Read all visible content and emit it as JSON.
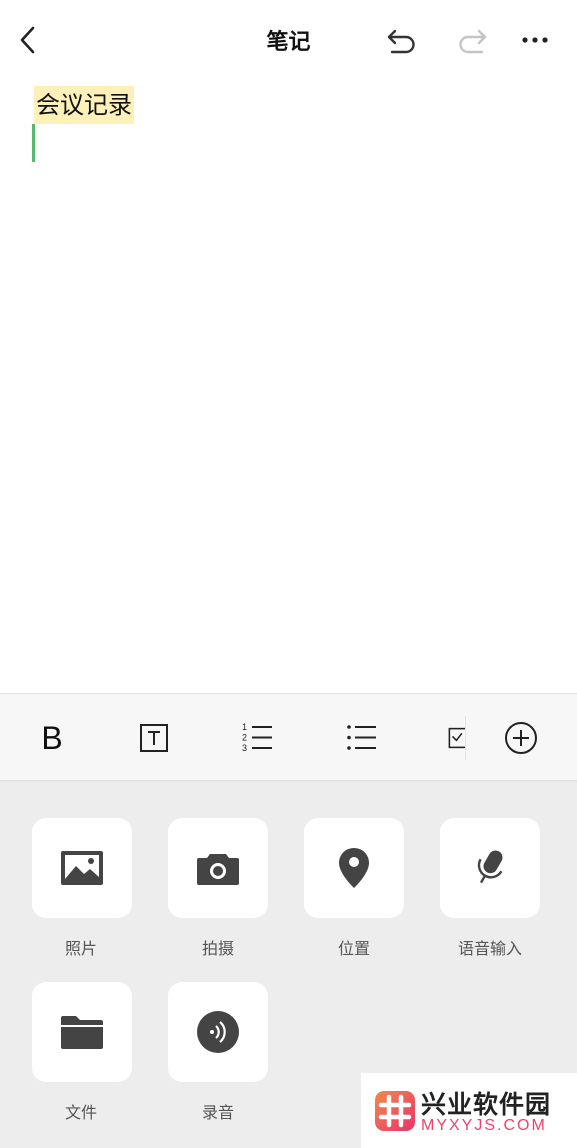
{
  "header": {
    "title": "笔记",
    "icons": [
      "back-arrow-icon",
      "undo-icon",
      "redo-icon",
      "more-icon"
    ]
  },
  "editor": {
    "lines": [
      "会议记录"
    ],
    "highlight_color": "#fdf0b8",
    "caret_color": "#59b86b"
  },
  "format_toolbar": {
    "bold_label": "B",
    "icons": [
      "text-style-icon",
      "numbered-list-icon",
      "bullet-list-icon",
      "checklist-icon",
      "add-circle-icon"
    ],
    "numbered_digits": [
      "1",
      "2",
      "3"
    ]
  },
  "attachments": {
    "items": [
      {
        "label": "照片",
        "icon": "photo-icon"
      },
      {
        "label": "拍摄",
        "icon": "camera-icon"
      },
      {
        "label": "位置",
        "icon": "location-pin-icon"
      },
      {
        "label": "语音输入",
        "icon": "microphone-icon"
      },
      {
        "label": "文件",
        "icon": "folder-icon"
      },
      {
        "label": "录音",
        "icon": "audio-record-icon"
      }
    ]
  },
  "watermark": {
    "name": "兴业软件园",
    "url": "MYXYJS.COM",
    "accent": "#f0416b"
  }
}
